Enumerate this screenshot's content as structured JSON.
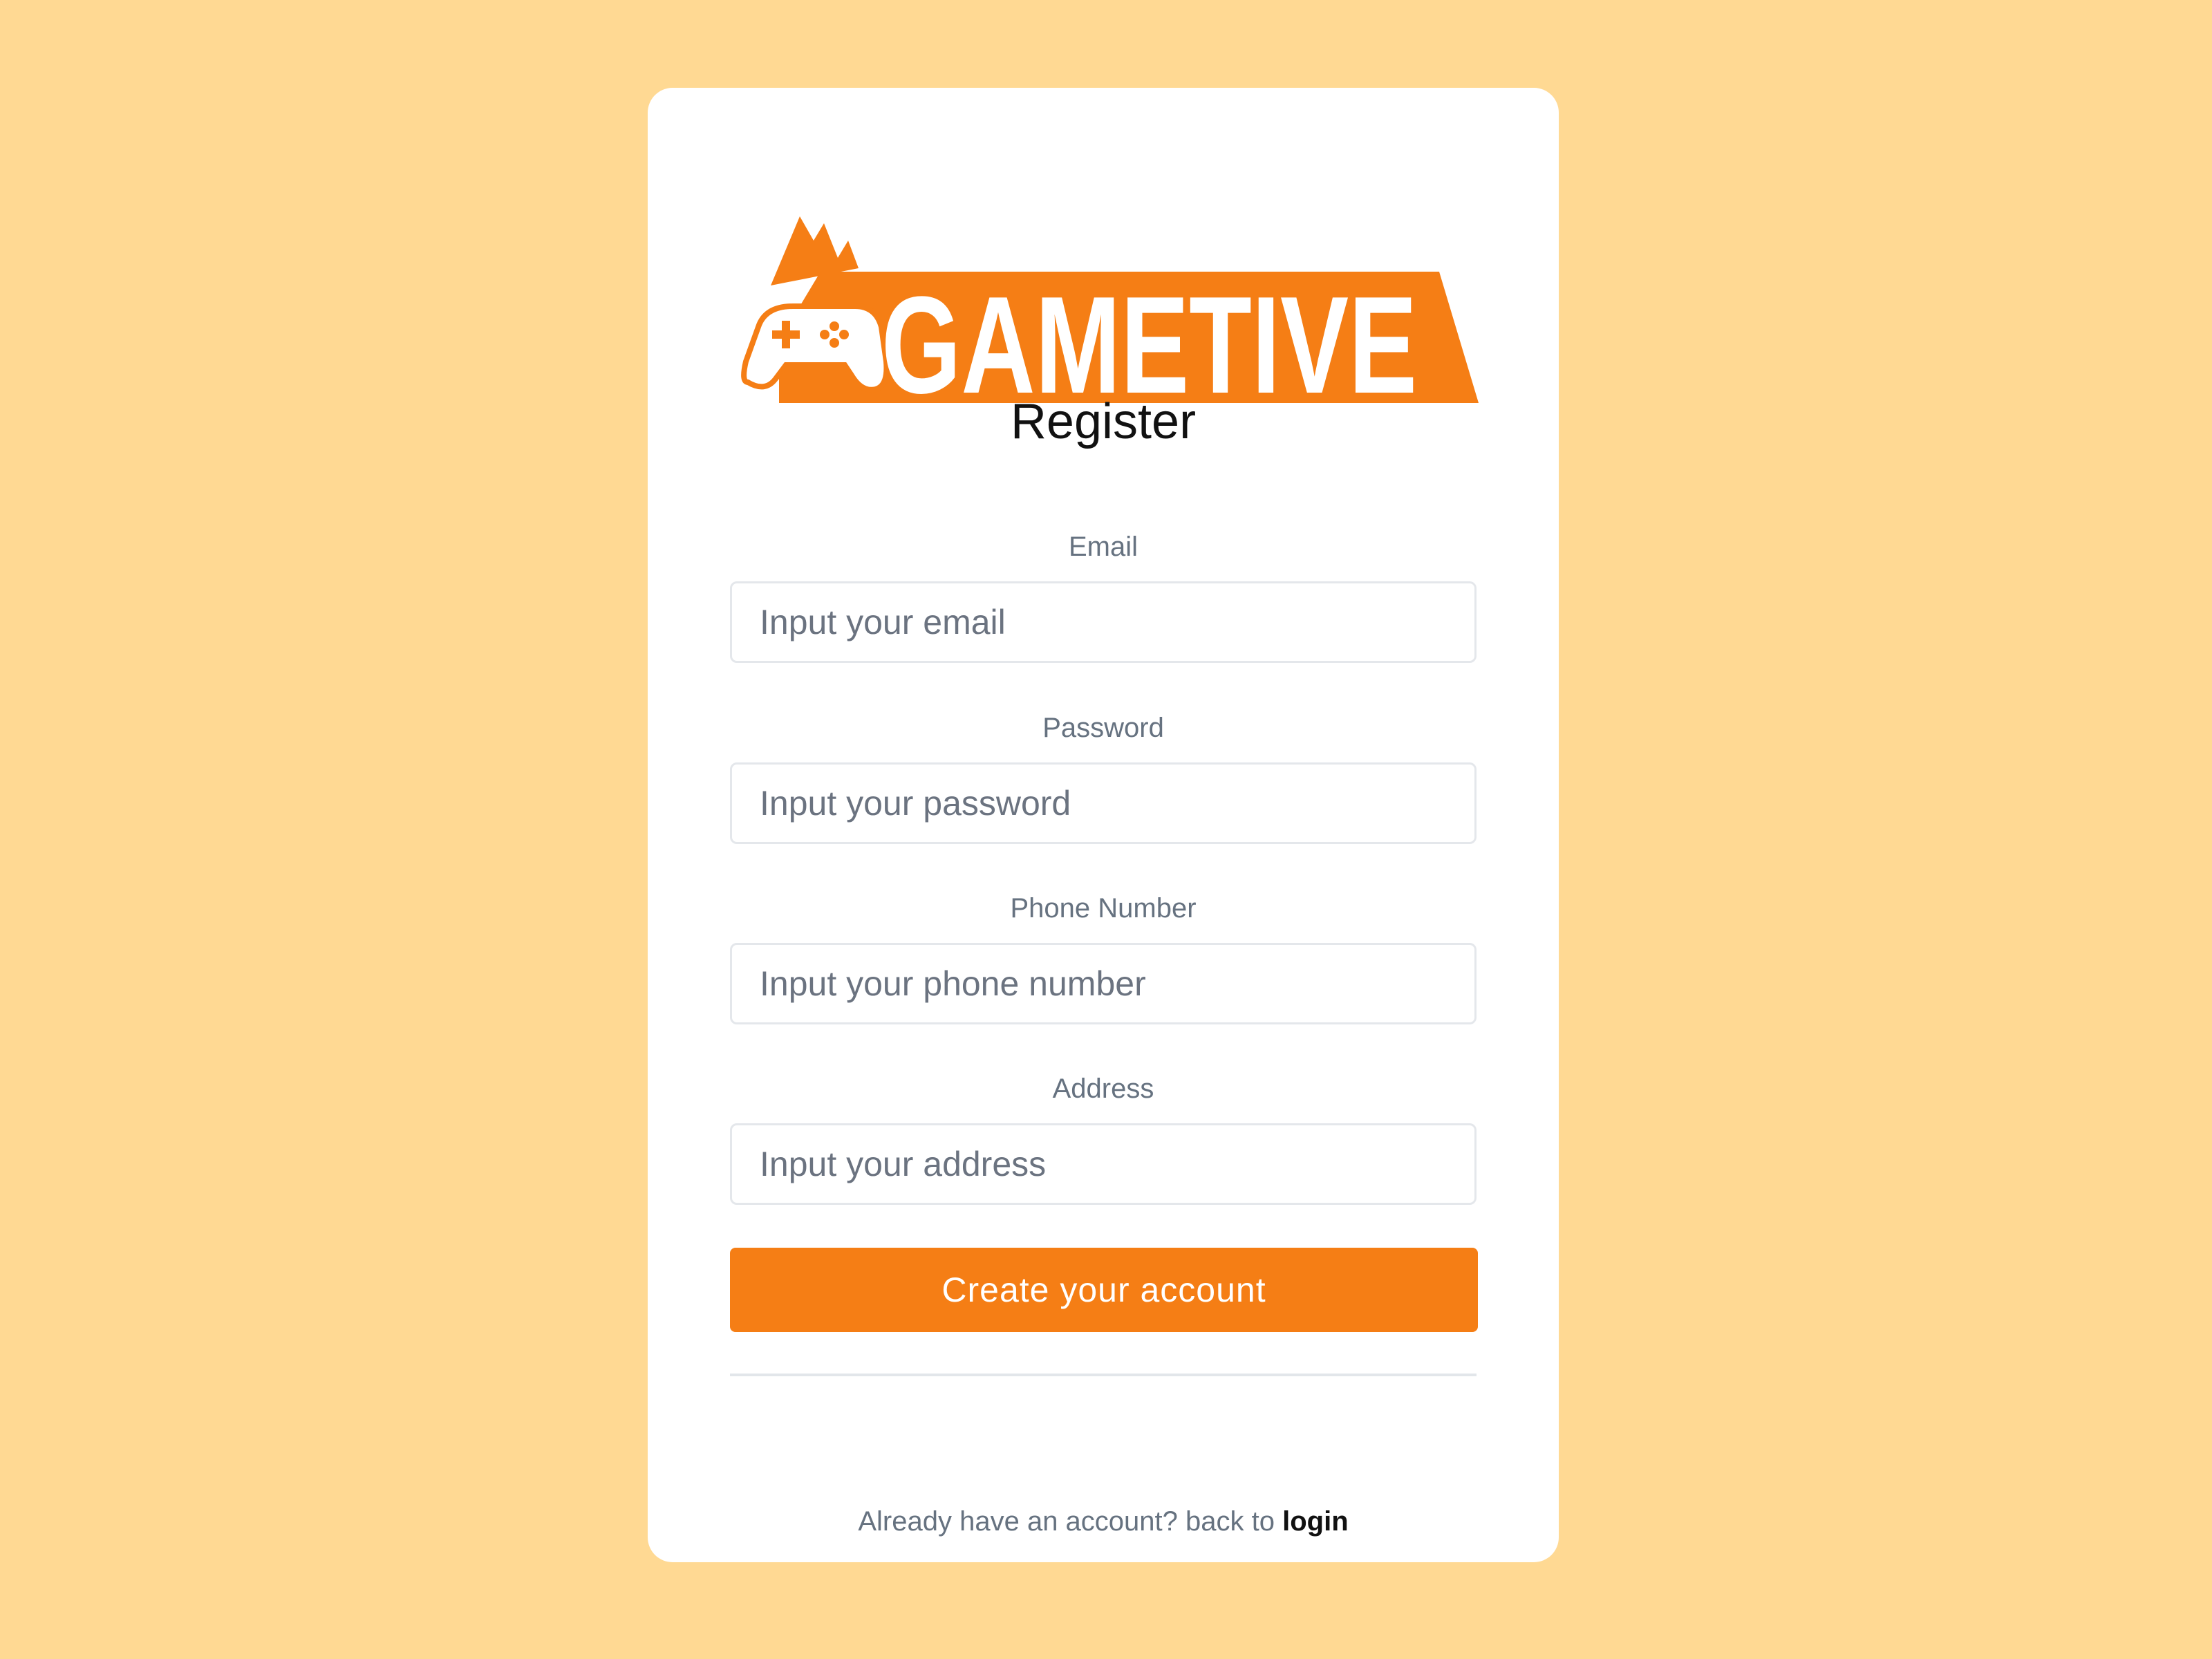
{
  "brand": {
    "name": "GAMETIVE",
    "accent_color": "#F57E15",
    "background_color": "#FFD993"
  },
  "form": {
    "title": "Register",
    "fields": [
      {
        "label": "Email",
        "placeholder": "Input your email"
      },
      {
        "label": "Password",
        "placeholder": "Input your password"
      },
      {
        "label": "Phone Number",
        "placeholder": "Input your phone number"
      },
      {
        "label": "Address",
        "placeholder": "Input your address"
      }
    ],
    "submit_label": "Create your account"
  },
  "footer": {
    "prompt": "Already have an account? back to",
    "link_label": "login"
  },
  "icons": [
    "gamepad-icon",
    "mountain-icon"
  ]
}
